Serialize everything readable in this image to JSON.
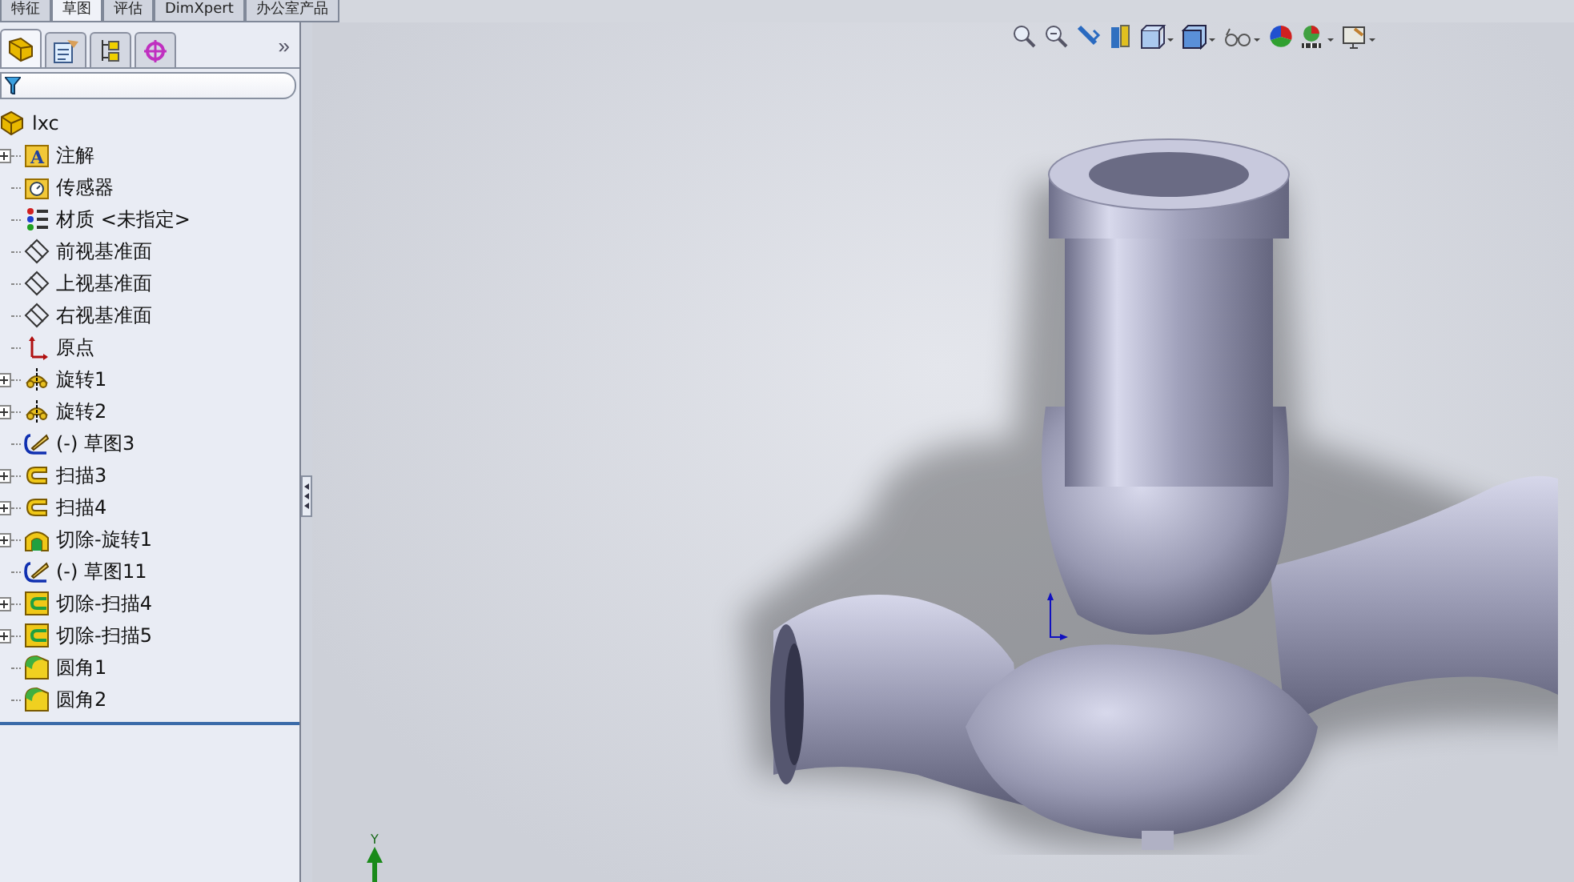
{
  "command_tabs": [
    {
      "label": "特征",
      "selected": false
    },
    {
      "label": "草图",
      "selected": true
    },
    {
      "label": "评估",
      "selected": false
    },
    {
      "label": "DimXpert",
      "selected": false
    },
    {
      "label": "办公室产品",
      "selected": false
    }
  ],
  "manager_tabs": [
    {
      "kind": "feature",
      "selected": true
    },
    {
      "kind": "property",
      "selected": false
    },
    {
      "kind": "config",
      "selected": false
    },
    {
      "kind": "display",
      "selected": false
    }
  ],
  "manager_more": "»",
  "tree": {
    "root": "lxc",
    "items": [
      {
        "label": "注解",
        "kind": "annotation",
        "icon_text": "A",
        "expandable": true
      },
      {
        "label": "传感器",
        "kind": "sensor",
        "expandable": false
      },
      {
        "label": "材质 <未指定>",
        "kind": "material",
        "expandable": false
      },
      {
        "label": "前视基准面",
        "kind": "plane",
        "expandable": false
      },
      {
        "label": "上视基准面",
        "kind": "plane",
        "expandable": false
      },
      {
        "label": "右视基准面",
        "kind": "plane",
        "expandable": false
      },
      {
        "label": "原点",
        "kind": "origin",
        "expandable": false
      },
      {
        "label": "旋转1",
        "kind": "revolve",
        "expandable": true
      },
      {
        "label": "旋转2",
        "kind": "revolve",
        "expandable": true
      },
      {
        "label": "(-) 草图3",
        "kind": "sketch",
        "expandable": false
      },
      {
        "label": "扫描3",
        "kind": "sweep",
        "expandable": true
      },
      {
        "label": "扫描4",
        "kind": "sweep",
        "expandable": true
      },
      {
        "label": "切除-旋转1",
        "kind": "cut-revolve",
        "expandable": true
      },
      {
        "label": "(-) 草图11",
        "kind": "sketch",
        "expandable": false
      },
      {
        "label": "切除-扫描4",
        "kind": "cut-sweep",
        "expandable": true
      },
      {
        "label": "切除-扫描5",
        "kind": "cut-sweep",
        "expandable": true
      },
      {
        "label": "圆角1",
        "kind": "fillet",
        "expandable": false
      },
      {
        "label": "圆角2",
        "kind": "fillet",
        "expandable": false
      }
    ]
  },
  "viewport": {
    "axis_label": "Y"
  }
}
